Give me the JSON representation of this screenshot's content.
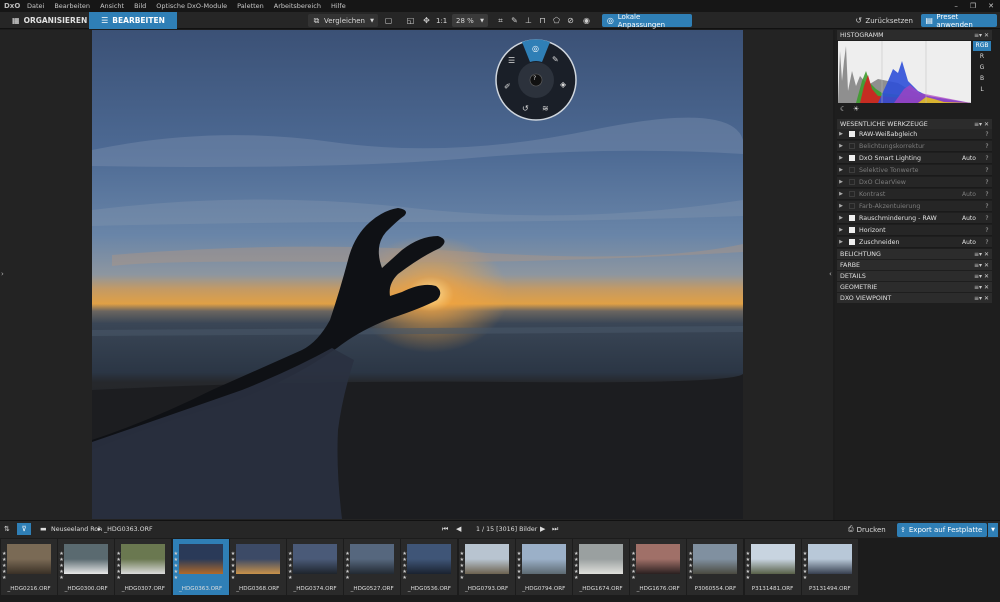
{
  "app": {
    "logo": "DxO",
    "menu": [
      "Datei",
      "Bearbeiten",
      "Ansicht",
      "Bild",
      "Optische DxO-Module",
      "Paletten",
      "Arbeitsbereich",
      "Hilfe"
    ]
  },
  "toolbar": {
    "tab_organize": "ORGANISIEREN",
    "tab_edit": "BEARBEITEN",
    "compare_label": "Vergleichen",
    "zoom_1to1": "1:1",
    "zoom_value": "28 %",
    "local_adjust_label": "Lokale Anpassungen",
    "reset_label": "Zurücksetzen",
    "apply_preset_label": "Preset anwenden"
  },
  "histogram": {
    "title": "HISTOGRAMM",
    "channels": [
      "RGB",
      "R",
      "G",
      "B",
      "L"
    ],
    "selected": "RGB"
  },
  "tools": {
    "title": "WESENTLICHE WERKZEUGE",
    "items": [
      {
        "label": "RAW-Weißabgleich",
        "auto": "",
        "enabled": true
      },
      {
        "label": "Belichtungskorrektur",
        "auto": "",
        "enabled": false
      },
      {
        "label": "DxO Smart Lighting",
        "auto": "Auto",
        "enabled": true
      },
      {
        "label": "Selektive Tonwerte",
        "auto": "",
        "enabled": false
      },
      {
        "label": "DxO ClearView",
        "auto": "",
        "enabled": false
      },
      {
        "label": "Kontrast",
        "auto": "Auto",
        "enabled": false
      },
      {
        "label": "Farb-Akzentuierung",
        "auto": "",
        "enabled": false
      },
      {
        "label": "Rauschminderung - RAW",
        "auto": "Auto",
        "enabled": true
      },
      {
        "label": "Horizont",
        "auto": "",
        "enabled": true
      },
      {
        "label": "Zuschneiden",
        "auto": "Auto",
        "enabled": true
      }
    ],
    "help": "?"
  },
  "palettes": [
    "BELICHTUNG",
    "FARBE",
    "DETAILS",
    "GEOMETRIE",
    "DXO VIEWPOINT"
  ],
  "filmstrip_bar": {
    "path": "Neuseeland Roh",
    "current_file": "_HDG0363.ORF",
    "counter": "1 / 15 [3016] Bilder",
    "print_label": "Drucken",
    "export_label": "Export auf Festplatte"
  },
  "filmstrip": [
    {
      "name": "_HDG0216.ORF",
      "c1": "#7a6a55",
      "c2": "#3a3026"
    },
    {
      "name": "_HDG0300.ORF",
      "c1": "#5a6a70",
      "c2": "#e8e8e8"
    },
    {
      "name": "_HDG0307.ORF",
      "c1": "#6a7850",
      "c2": "#dcdcdc"
    },
    {
      "name": "_HDG0363.ORF",
      "c1": "#2a3a58",
      "c2": "#b06a2a"
    },
    {
      "name": "_HDG0368.ORF",
      "c1": "#3c4a66",
      "c2": "#c9924a"
    },
    {
      "name": "_HDG0374.ORF",
      "c1": "#4a5a78",
      "c2": "#1e242c"
    },
    {
      "name": "_HDG0527.ORF",
      "c1": "#56677e",
      "c2": "#222a33"
    },
    {
      "name": "_HDG0536.ORF",
      "c1": "#3f5577",
      "c2": "#1a2230"
    },
    {
      "name": "_HDG0793.ORF",
      "c1": "#b8c4d0",
      "c2": "#6d6250"
    },
    {
      "name": "_HDG0794.ORF",
      "c1": "#9bb0c8",
      "c2": "#5d6a72"
    },
    {
      "name": "_HDG1674.ORF",
      "c1": "#9aa0a0",
      "c2": "#e0e0dc"
    },
    {
      "name": "_HDG1676.ORF",
      "c1": "#a07068",
      "c2": "#2a2020"
    },
    {
      "name": "P3060554.ORF",
      "c1": "#8090a0",
      "c2": "#4a4a40"
    },
    {
      "name": "P3131481.ORF",
      "c1": "#c8d4e0",
      "c2": "#586048"
    },
    {
      "name": "P3131494.ORF",
      "c1": "#b8c8d8",
      "c2": "#384050"
    }
  ]
}
